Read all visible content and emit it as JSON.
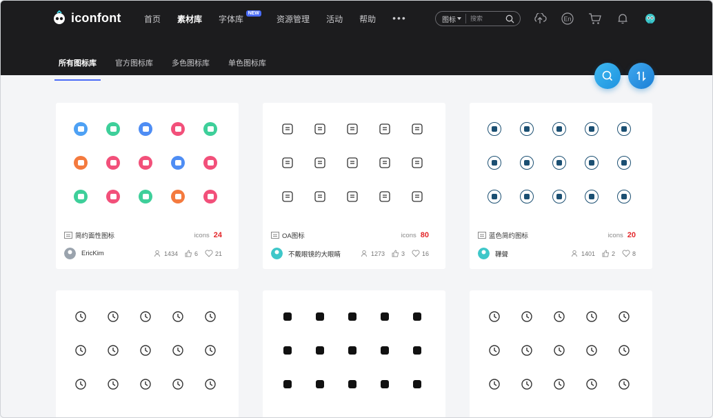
{
  "brand": {
    "logo_text": "iconfont"
  },
  "nav": [
    {
      "label": "首页",
      "active": false
    },
    {
      "label": "素材库",
      "active": true
    },
    {
      "label": "字体库",
      "active": false,
      "badge": "NEW"
    },
    {
      "label": "资源管理",
      "active": false
    },
    {
      "label": "活动",
      "active": false
    },
    {
      "label": "帮助",
      "active": false
    }
  ],
  "nav_more": "•••",
  "search": {
    "type_label": "图标",
    "placeholder": "搜索"
  },
  "top_icons": [
    "upload-icon",
    "language-icon",
    "cart-icon",
    "bell-icon",
    "user-avatar"
  ],
  "language_label": "En",
  "tabs": [
    {
      "label": "所有图标库",
      "active": true
    },
    {
      "label": "官方图标库",
      "active": false
    },
    {
      "label": "多色图标库",
      "active": false
    },
    {
      "label": "单色图标库",
      "active": false
    }
  ],
  "colors": {
    "accent": "#4a6cf7",
    "count_red": "#e3262a",
    "dark_icon": "#1b4f72"
  },
  "cards": [
    {
      "title": "简约面性图标",
      "icons_label": "icons",
      "count": "24",
      "author": "EricKim",
      "stats": {
        "collect": "1434",
        "likes": "6",
        "favorites": "21"
      },
      "style": "color",
      "icons": [
        "#4ea1f4",
        "#3ecf9a",
        "#4e8df4",
        "#f2507a",
        "#3ecf9a",
        "#f47a3e",
        "#f2507a",
        "#f2507a",
        "#4e8df4",
        "#f2507a",
        "#3ecf9a",
        "#f2507a",
        "#3ecf9a",
        "#f47a3e",
        "#f2507a"
      ]
    },
    {
      "title": "OA图标",
      "icons_label": "icons",
      "count": "80",
      "author": "不戴眼镜的大眼睛",
      "stats": {
        "collect": "1273",
        "likes": "3",
        "favorites": "16"
      },
      "style": "outline",
      "icons": [
        "shield-icon",
        "document-icon",
        "report-icon",
        "airplane-icon",
        "box-icon",
        "person-icon",
        "person-search-icon",
        "star-icon",
        "badge-icon",
        "window-icon",
        "fuel-icon",
        "checklist-icon",
        "house-icon",
        "billboard-icon",
        "car-icon"
      ]
    },
    {
      "title": "蓝色简约图标",
      "icons_label": "icons",
      "count": "20",
      "author": "鞾聲",
      "stats": {
        "collect": "1401",
        "likes": "2",
        "favorites": "8"
      },
      "style": "dark",
      "icons": [
        "speaker-icon",
        "speaker-icon",
        "chart-icon",
        "tool-icon",
        "image-icon",
        "link-icon",
        "book-icon",
        "picture-icon",
        "location-icon",
        "target-icon",
        "user-icon",
        "clock-icon",
        "person-icon",
        "gauge-icon",
        "edit-icon"
      ]
    },
    {
      "style": "line",
      "icons": [
        "map-pin-icon",
        "box-icon",
        "printer-icon",
        "arrow-down-left-icon",
        "arrow-left-icon",
        "arrow-down-icon",
        "volleyball-icon",
        "magnet-icon",
        "basketball-icon",
        "crosshair-icon",
        "alarm-icon",
        "arrow-down-right-icon",
        "apple-icon",
        "chat-icon",
        "bicycle-icon"
      ]
    },
    {
      "style": "solid",
      "icons": [
        "clipboard-icon",
        "ticket-icon",
        "location-icon",
        "search-user-icon",
        "person-icon",
        "home-icon",
        "note-icon",
        "mail-icon",
        "support-icon",
        "heart-icon",
        "bell-icon",
        "cloud-upload-icon",
        "cart-icon",
        "card-icon",
        "grid-icon"
      ]
    },
    {
      "style": "line",
      "icons": [
        "camera-icon",
        "scan-icon",
        "calendar-icon",
        "upload-icon",
        "minimize-icon",
        "close-circle-icon",
        "form-icon",
        "chevron-down-icon",
        "chevron-down-icon",
        "home-solid-icon",
        "pie-chart-icon",
        "zoom-out-icon",
        "refresh-icon",
        "alert-icon",
        "info-icon"
      ]
    }
  ]
}
